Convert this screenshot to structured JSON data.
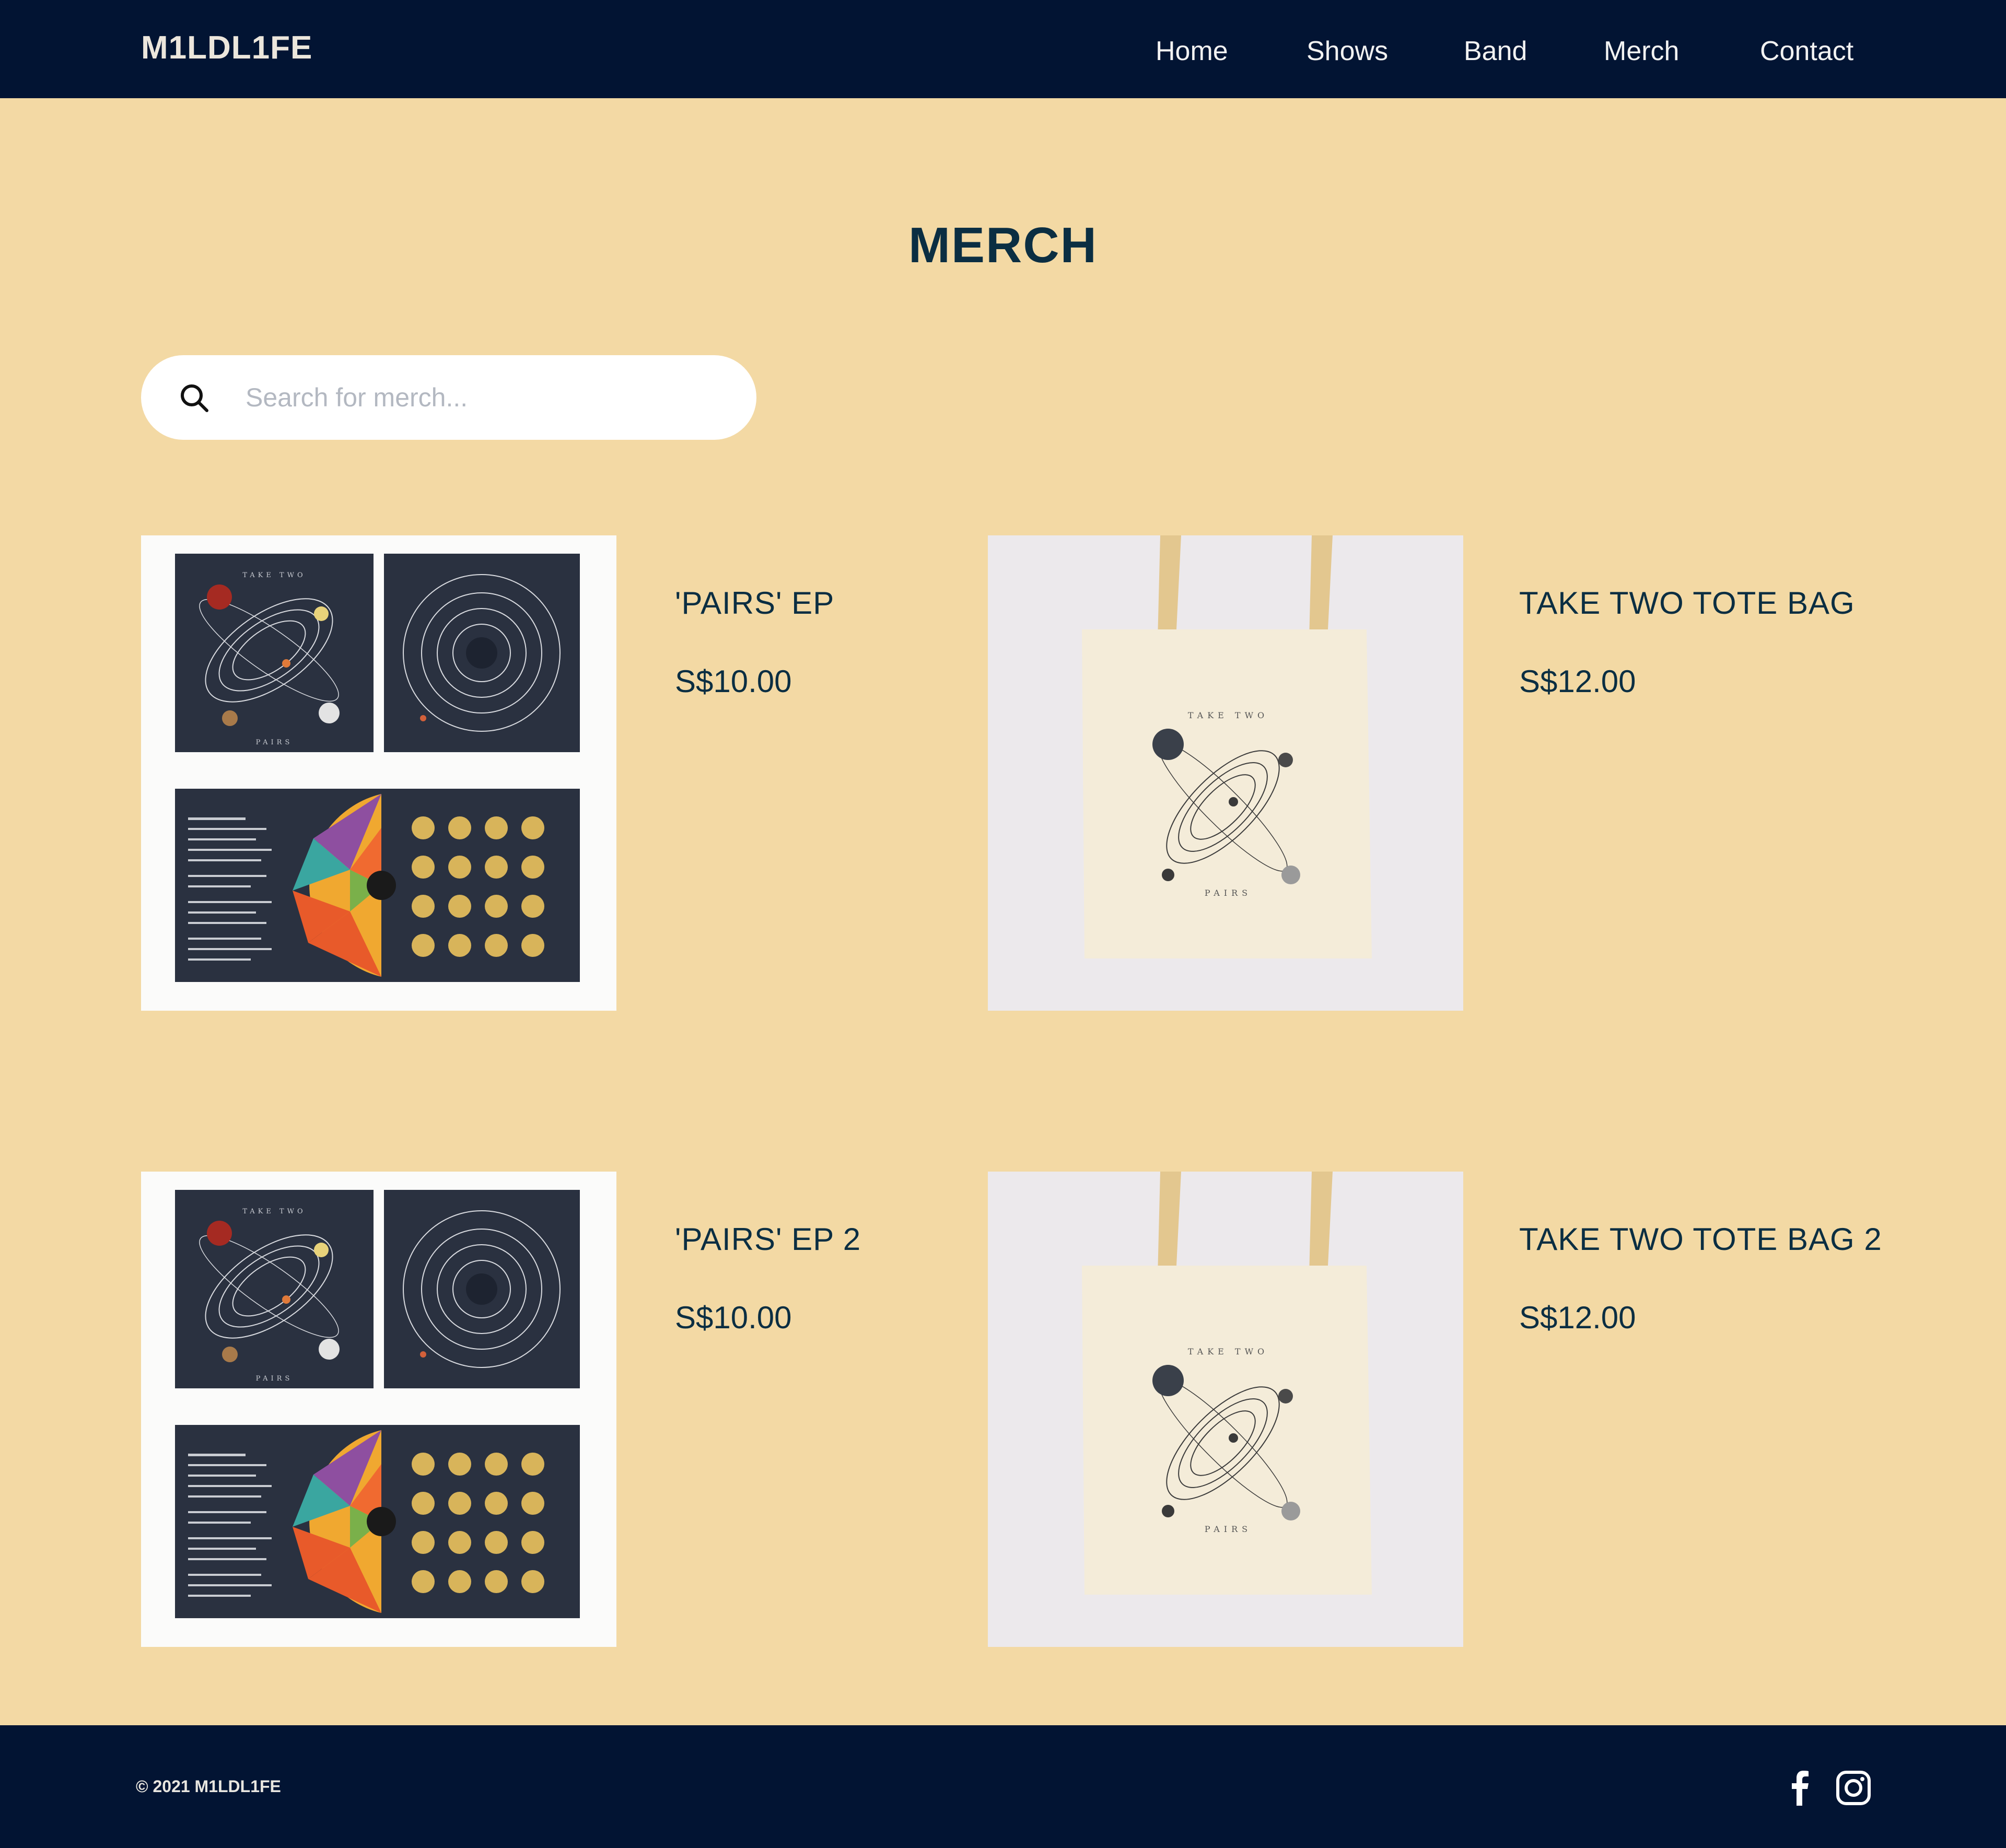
{
  "header": {
    "logo": "M1LDL1FE",
    "nav": [
      "Home",
      "Shows",
      "Band",
      "Merch",
      "Contact"
    ]
  },
  "page": {
    "title": "MERCH"
  },
  "search": {
    "placeholder": "Search for merch..."
  },
  "products": [
    {
      "name": "'PAIRS' EP",
      "price": "S$10.00",
      "image": "pairs-ep-cd-packaging"
    },
    {
      "name": "TAKE TWO TOTE BAG",
      "price": "S$12.00",
      "image": "take-two-tote-bag"
    },
    {
      "name": "'PAIRS' EP 2",
      "price": "S$10.00",
      "image": "pairs-ep-cd-packaging"
    },
    {
      "name": "TAKE TWO TOTE BAG 2",
      "price": "S$12.00",
      "image": "take-two-tote-bag"
    }
  ],
  "artwork": {
    "ep_cover_top": "TAKE TWO",
    "ep_cover_bottom": "PAIRS",
    "tote_top": "TAKE TWO",
    "tote_bottom": "PAIRS"
  },
  "footer": {
    "copyright": "© 2021 M1LDL1FE",
    "social": [
      "facebook-icon",
      "instagram-icon"
    ]
  },
  "colors": {
    "navbar": "#021433",
    "background": "#f3d9a4",
    "heading": "#0b2e42"
  }
}
